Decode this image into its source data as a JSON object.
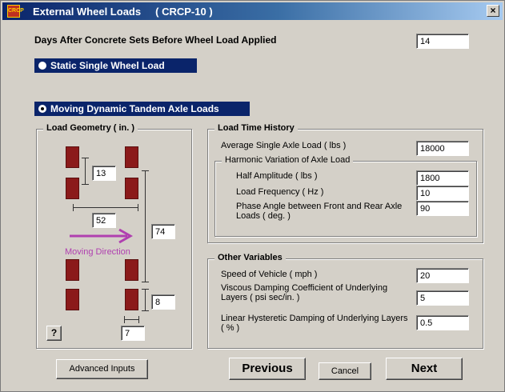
{
  "window": {
    "title": "External Wheel Loads     ( CRCP-10 )",
    "app_icon_text": "CRCP",
    "close_label": "×"
  },
  "days": {
    "label": "Days After Concrete Sets Before Wheel Load Applied",
    "value": "14"
  },
  "load_options": {
    "static": {
      "label": "Static Single Wheel Load",
      "selected": false
    },
    "moving": {
      "label": "Moving Dynamic Tandem Axle Loads",
      "selected": true
    }
  },
  "load_geometry": {
    "title": "Load Geometry ( in. )",
    "wheel_gap": "13",
    "axle_width": "52",
    "axle_spacing": "74",
    "tire_length": "8",
    "tire_width": "7",
    "direction_label": "Moving Direction",
    "help_label": "?"
  },
  "load_time_history": {
    "title": "Load Time History",
    "average_axle_load": {
      "label": "Average Single Axle Load ( lbs )",
      "value": "18000"
    },
    "harmonic_group_title": "Harmonic Variation of Axle Load",
    "half_amplitude": {
      "label": "Half Amplitude ( lbs )",
      "value": "1800"
    },
    "load_frequency": {
      "label": "Load Frequency ( Hz )",
      "value": "10"
    },
    "phase_angle": {
      "label": "Phase Angle between Front and Rear Axle Loads ( deg. )",
      "value": "90"
    }
  },
  "other_variables": {
    "title": "Other Variables",
    "speed": {
      "label": "Speed of Vehicle ( mph )",
      "value": "20"
    },
    "viscous_damping": {
      "label": "Viscous Damping Coefficient of Underlying Layers ( psi sec/in. )",
      "value": "5"
    },
    "hysteretic_damping": {
      "label": "Linear Hysteretic Damping of Underlying Layers ( % )",
      "value": "0.5"
    }
  },
  "buttons": {
    "advanced": "Advanced Inputs",
    "previous": "Previous",
    "cancel": "Cancel",
    "next": "Next"
  },
  "colors": {
    "title_bar": "#0a246a",
    "selection": "#0a246a",
    "wheel": "#8b1a1a",
    "arrow": "#b040b0",
    "dialog": "#d4d0c8"
  }
}
